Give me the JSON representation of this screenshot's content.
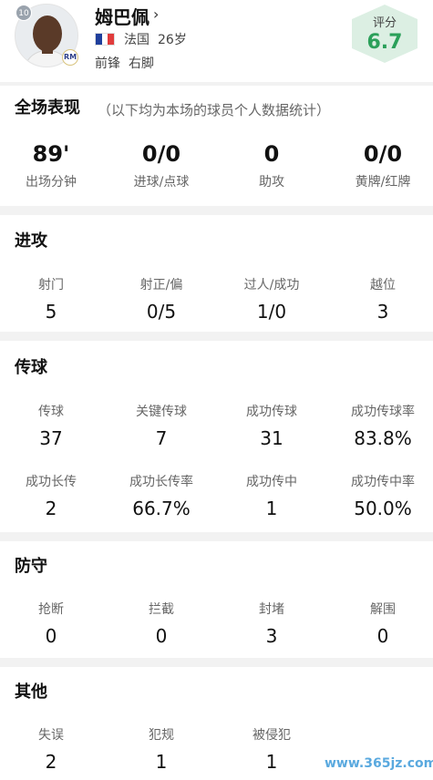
{
  "player": {
    "jersey_number": "10",
    "name": "姆巴佩",
    "name_arrow": "›",
    "country": "法国",
    "age": "26岁",
    "position": "前锋",
    "foot": "右脚",
    "club_badge": "RM"
  },
  "rating": {
    "label": "评分",
    "value": "6.7"
  },
  "overview": {
    "title": "全场表现",
    "note": "（以下均为本场的球员个人数据统计）",
    "stats": [
      {
        "value": "89'",
        "label": "出场分钟"
      },
      {
        "value": "0/0",
        "label": "进球/点球"
      },
      {
        "value": "0",
        "label": "助攻"
      },
      {
        "value": "0/0",
        "label": "黄牌/红牌"
      }
    ]
  },
  "attack": {
    "title": "进攻",
    "stats": [
      {
        "label": "射门",
        "value": "5"
      },
      {
        "label": "射正/偏",
        "value": "0/5"
      },
      {
        "label": "过人/成功",
        "value": "1/0"
      },
      {
        "label": "越位",
        "value": "3"
      }
    ]
  },
  "passing": {
    "title": "传球",
    "stats": [
      {
        "label": "传球",
        "value": "37"
      },
      {
        "label": "关键传球",
        "value": "7"
      },
      {
        "label": "成功传球",
        "value": "31"
      },
      {
        "label": "成功传球率",
        "value": "83.8%"
      },
      {
        "label": "成功长传",
        "value": "2"
      },
      {
        "label": "成功长传率",
        "value": "66.7%"
      },
      {
        "label": "成功传中",
        "value": "1"
      },
      {
        "label": "成功传中率",
        "value": "50.0%"
      }
    ]
  },
  "defense": {
    "title": "防守",
    "stats": [
      {
        "label": "抢断",
        "value": "0"
      },
      {
        "label": "拦截",
        "value": "0"
      },
      {
        "label": "封堵",
        "value": "3"
      },
      {
        "label": "解围",
        "value": "0"
      }
    ]
  },
  "other": {
    "title": "其他",
    "stats": [
      {
        "label": "失误",
        "value": "2"
      },
      {
        "label": "犯规",
        "value": "1"
      },
      {
        "label": "被侵犯",
        "value": "1"
      }
    ]
  },
  "watermark": "www.365jz.com",
  "colors": {
    "rating_bg": "#dcefe3",
    "rating_text": "#2ba05a",
    "background": "#f2f2f2"
  }
}
